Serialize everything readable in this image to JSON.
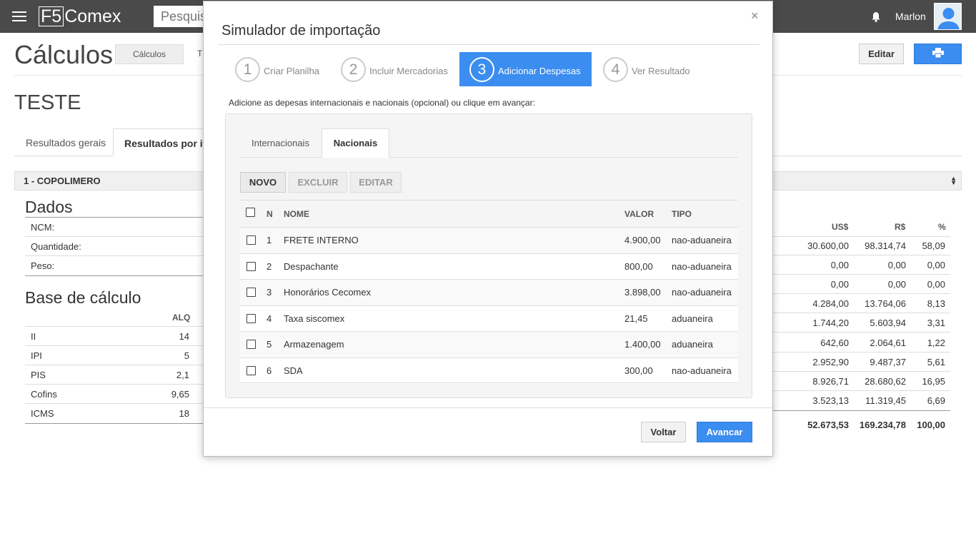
{
  "app": {
    "brand_prefix": "F5",
    "brand_suffix": "Comex",
    "search_placeholder": "Pesquisar",
    "username": "Marlon"
  },
  "page": {
    "title": "Cálculos",
    "breadcrumb": [
      "Cálculos",
      "T"
    ],
    "edit_label": "Editar",
    "subtitle": "TESTE",
    "tabs": [
      "Resultados gerais",
      "Resultados por item"
    ],
    "item_select": "1 - COPOLIMERO"
  },
  "dados": {
    "title": "Dados",
    "rows": [
      "NCM:",
      "Quantidade:",
      "Peso:"
    ]
  },
  "base": {
    "title": "Base de cálculo",
    "alq_header": "ALQ",
    "rows": [
      {
        "name": "II",
        "alq": "14"
      },
      {
        "name": "IPI",
        "alq": "5"
      },
      {
        "name": "PIS",
        "alq": "2,1"
      },
      {
        "name": "Cofins",
        "alq": "9,65"
      },
      {
        "name": "ICMS",
        "alq": "18"
      }
    ]
  },
  "right_table": {
    "headers": [
      "US$",
      "R$",
      "%"
    ],
    "rows": [
      [
        "30.600,00",
        "98.314,74",
        "58,09"
      ],
      [
        "0,00",
        "0,00",
        "0,00"
      ],
      [
        "0,00",
        "0,00",
        "0,00"
      ],
      [
        "4.284,00",
        "13.764,06",
        "8,13"
      ],
      [
        "1.744,20",
        "5.603,94",
        "3,31"
      ],
      [
        "642,60",
        "2.064,61",
        "1,22"
      ],
      [
        "2.952,90",
        "9.487,37",
        "5,61"
      ],
      [
        "8.926,71",
        "28.680,62",
        "16,95"
      ],
      [
        "3.523,13",
        "11.319,45",
        "6,69"
      ]
    ],
    "totals": [
      "52.673,53",
      "169.234,78",
      "100,00"
    ]
  },
  "modal": {
    "title": "Simulador de importação",
    "close": "×",
    "steps": [
      {
        "num": "1",
        "label": "Criar Planilha"
      },
      {
        "num": "2",
        "label": "Incluir Mercadorias"
      },
      {
        "num": "3",
        "label": "Adicionar Despesas"
      },
      {
        "num": "4",
        "label": "Ver Resultado"
      }
    ],
    "instruction": "Adicione as depesas internacionais e nacionais (opcional) ou clique em avançar:",
    "tabs": [
      "Internacionais",
      "Nacionais"
    ],
    "actions": {
      "novo": "NOVO",
      "excluir": "EXCLUIR",
      "editar": "EDITAR"
    },
    "table": {
      "headers": {
        "n": "N",
        "nome": "NOME",
        "valor": "VALOR",
        "tipo": "TIPO"
      },
      "rows": [
        {
          "n": "1",
          "nome": "FRETE INTERNO",
          "valor": "4.900,00",
          "tipo": "nao-aduaneira"
        },
        {
          "n": "2",
          "nome": "Despachante",
          "valor": "800,00",
          "tipo": "nao-aduaneira"
        },
        {
          "n": "3",
          "nome": "Honorários Cecomex",
          "valor": "3.898,00",
          "tipo": "nao-aduaneira"
        },
        {
          "n": "4",
          "nome": "Taxa siscomex",
          "valor": "21,45",
          "tipo": "aduaneira"
        },
        {
          "n": "5",
          "nome": "Armazenagem",
          "valor": "1.400,00",
          "tipo": "aduaneira"
        },
        {
          "n": "6",
          "nome": "SDA",
          "valor": "300,00",
          "tipo": "nao-aduaneira"
        }
      ]
    },
    "back_label": "Voltar",
    "next_label": "Avancar"
  },
  "colors": {
    "accent": "#3b8def",
    "topbar": "#4a4a4a"
  }
}
